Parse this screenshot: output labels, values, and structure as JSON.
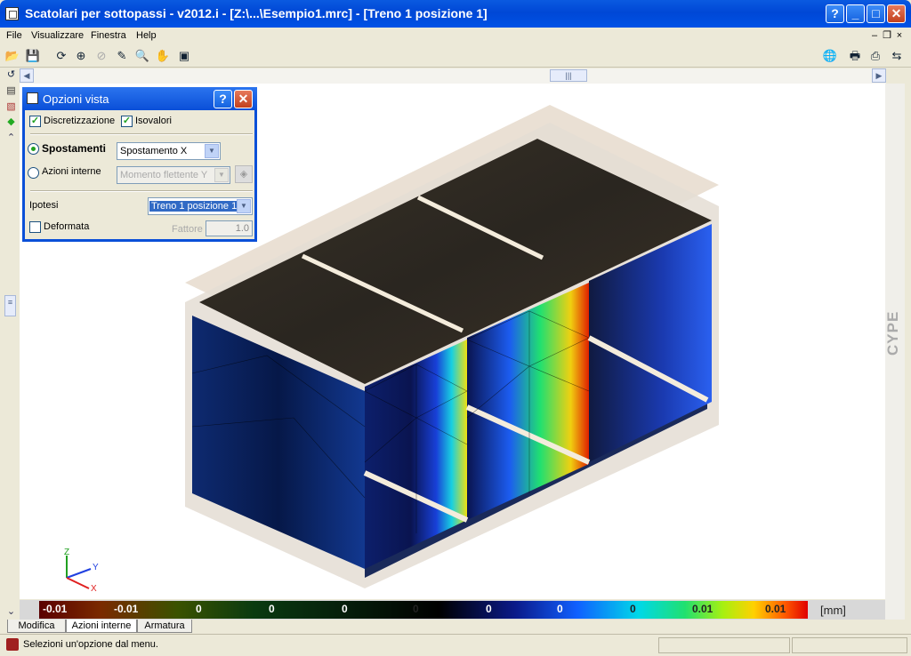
{
  "window": {
    "title": "Scatolari per sottopassi - v2012.i - [Z:\\...\\Esempio1.mrc] - [Treno 1 posizione 1]"
  },
  "menu": [
    "File",
    "Visualizzare",
    "Finestra",
    "Help"
  ],
  "dialog": {
    "title": "Opzioni vista",
    "discretizzazione": {
      "label": "Discretizzazione",
      "checked": true
    },
    "isovalori": {
      "label": "Isovalori",
      "checked": true
    },
    "spostamenti": {
      "label": "Spostamenti",
      "value": "Spostamento X",
      "selected": true
    },
    "azioni_interne": {
      "label": "Azioni interne",
      "value": "Momento flettente Y",
      "selected": false
    },
    "ipotesi": {
      "label": "Ipotesi",
      "value": "Treno 1 posizione 1"
    },
    "deformata": {
      "label": "Deformata",
      "checked": false
    },
    "fattore": {
      "label": "Fattore",
      "value": "1.0"
    }
  },
  "brand": "CYPE",
  "legend": {
    "values": [
      "-0.01",
      "-0.01",
      "0",
      "0",
      "0",
      "0",
      "0",
      "0",
      "0",
      "0.01",
      "0.01"
    ],
    "unit": "[mm]"
  },
  "axes": {
    "x": "X",
    "y": "Y",
    "z": "Z"
  },
  "tabs": [
    "Modifica",
    "Azioni interne",
    "Armatura"
  ],
  "status": {
    "message": "Selezioni un'opzione dal menu."
  }
}
